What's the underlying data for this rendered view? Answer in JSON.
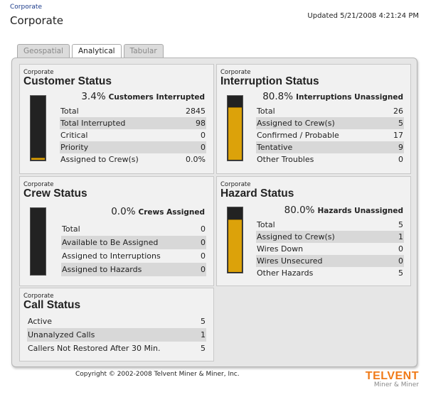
{
  "header": {
    "breadcrumb": "Corporate",
    "title": "Corporate",
    "updated": "Updated 5/21/2008 4:21:24 PM"
  },
  "tabs": [
    {
      "label": "Geospatial",
      "active": false
    },
    {
      "label": "Analytical",
      "active": true
    },
    {
      "label": "Tabular",
      "active": false
    }
  ],
  "colors": {
    "gauge_fill": "#dca20a",
    "gauge_empty": "#222222",
    "brand": "#f07a18"
  },
  "customer": {
    "context": "Corporate",
    "title": "Customer Status",
    "percent": "3.4%",
    "percent_label": "Customers Interrupted",
    "fill_fraction": 0.034,
    "rows": [
      {
        "label": "Total",
        "value": "2845"
      },
      {
        "label": "Total Interrupted",
        "value": "98"
      },
      {
        "label": "Critical",
        "value": "0"
      },
      {
        "label": "Priority",
        "value": "0"
      },
      {
        "label": "Assigned to Crew(s)",
        "value": "0.0%"
      }
    ]
  },
  "interruption": {
    "context": "Corporate",
    "title": "Interruption Status",
    "percent": "80.8%",
    "percent_label": "Interruptions Unassigned",
    "fill_fraction": 0.808,
    "rows": [
      {
        "label": "Total",
        "value": "26"
      },
      {
        "label": "Assigned to Crew(s)",
        "value": "5"
      },
      {
        "label": "Confirmed / Probable",
        "value": "17"
      },
      {
        "label": "Tentative",
        "value": "9"
      },
      {
        "label": "Other Troubles",
        "value": "0"
      }
    ]
  },
  "crew": {
    "context": "Corporate",
    "title": "Crew Status",
    "percent": "0.0%",
    "percent_label": "Crews Assigned",
    "fill_fraction": 0.0,
    "rows": [
      {
        "label": "Total",
        "value": "0"
      },
      {
        "label": "Available to Be Assigned",
        "value": "0"
      },
      {
        "label": "Assigned to Interruptions",
        "value": "0"
      },
      {
        "label": "Assigned to Hazards",
        "value": "0"
      }
    ]
  },
  "hazard": {
    "context": "Corporate",
    "title": "Hazard Status",
    "percent": "80.0%",
    "percent_label": "Hazards Unassigned",
    "fill_fraction": 0.8,
    "rows": [
      {
        "label": "Total",
        "value": "5"
      },
      {
        "label": "Assigned to Crew(s)",
        "value": "1"
      },
      {
        "label": "Wires Down",
        "value": "0"
      },
      {
        "label": "Wires Unsecured",
        "value": "0"
      },
      {
        "label": "Other Hazards",
        "value": "5"
      }
    ]
  },
  "call": {
    "context": "Corporate",
    "title": "Call Status",
    "rows": [
      {
        "label": "Active",
        "value": "5"
      },
      {
        "label": "Unanalyzed Calls",
        "value": "1"
      },
      {
        "label": "Callers Not Restored After 30 Min.",
        "value": "5"
      }
    ]
  },
  "footer": {
    "copyright": "Copyright © 2002-2008 Telvent Miner & Miner, Inc.",
    "brand": "TELVENT",
    "brand_sub": "Miner & Miner"
  }
}
